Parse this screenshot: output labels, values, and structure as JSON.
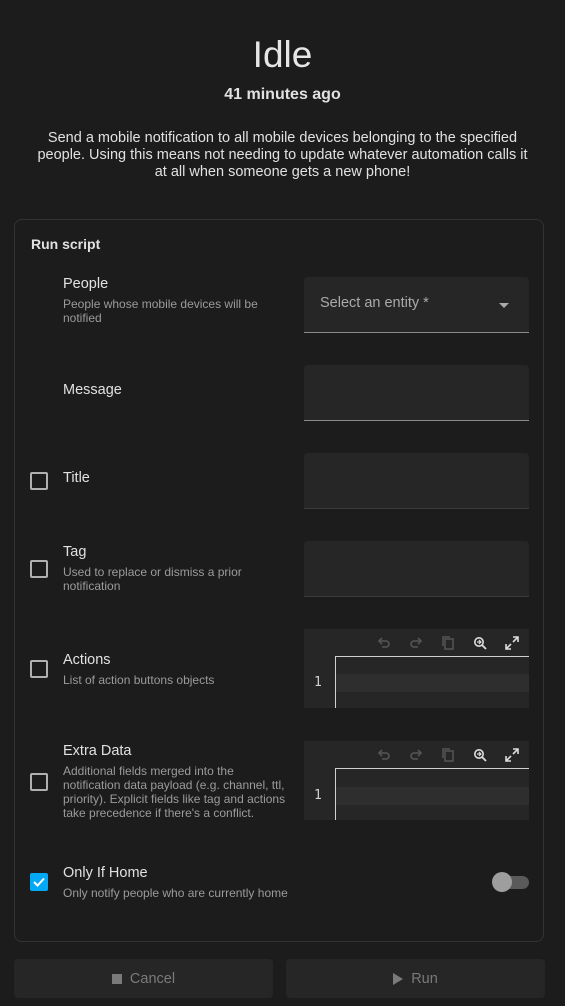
{
  "header": {
    "state": "Idle",
    "last_changed": "41 minutes ago",
    "description": "Send a mobile notification to all mobile devices belonging to the specified people. Using this means not needing to update whatever automation calls it at all when someone gets a new phone!"
  },
  "card": {
    "title": "Run script",
    "fields": {
      "people": {
        "label": "People",
        "helper": "People whose mobile devices will be notified",
        "placeholder": "Select an entity *"
      },
      "message": {
        "label": "Message"
      },
      "title": {
        "label": "Title",
        "enabled": false
      },
      "tag": {
        "label": "Tag",
        "helper": "Used to replace or dismiss a prior notification",
        "enabled": false
      },
      "actions": {
        "label": "Actions",
        "helper": "List of action buttons objects",
        "enabled": false,
        "line_number": "1"
      },
      "extra_data": {
        "label": "Extra Data",
        "helper": "Additional fields merged into the notification data payload (e.g. channel, ttl, priority). Explicit fields like tag and actions take precedence if there's a conflict.",
        "enabled": false,
        "line_number": "1"
      },
      "only_if_home": {
        "label": "Only If Home",
        "helper": "Only notify people who are currently home",
        "enabled": true,
        "toggle_on": false
      }
    }
  },
  "buttons": {
    "cancel": "Cancel",
    "run": "Run"
  },
  "colors": {
    "accent": "#03a9f4",
    "background": "#1c1c1c",
    "field": "#262626"
  },
  "icons": [
    "undo-icon",
    "redo-icon",
    "copy-icon",
    "search-replace-icon",
    "fullscreen-icon",
    "dropdown-caret-icon",
    "checkbox-icon",
    "stop-icon",
    "play-icon"
  ]
}
